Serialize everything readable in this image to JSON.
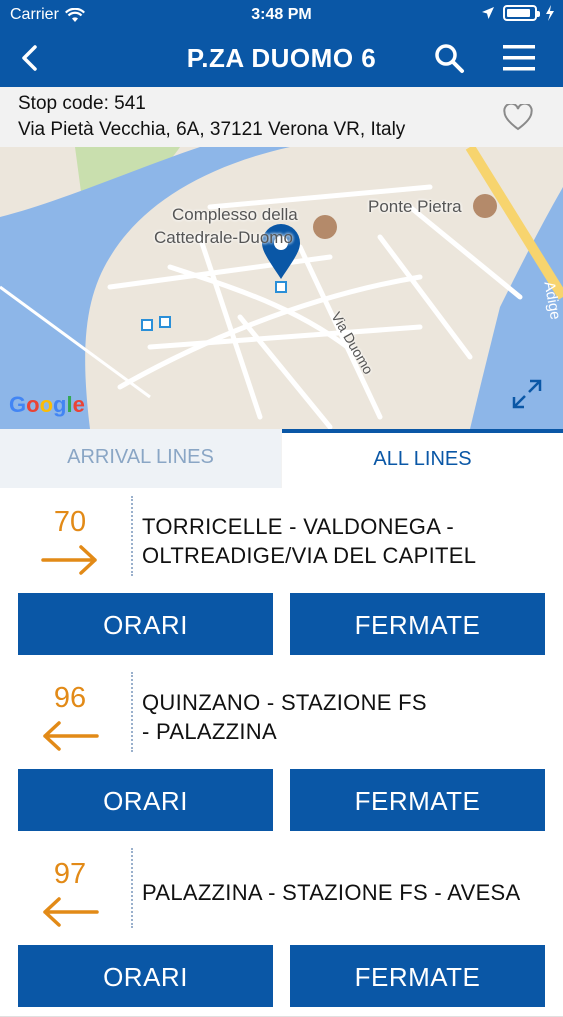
{
  "status_bar": {
    "carrier": "Carrier",
    "time": "3:48 PM",
    "battery_level": 0.9
  },
  "header": {
    "title": "P.ZA DUOMO 6"
  },
  "stop": {
    "code_label": "Stop code: 541",
    "address": "Via Pietà Vecchia, 6A, 37121 Verona VR, Italy"
  },
  "map": {
    "labels": {
      "complesso_1": "Complesso della",
      "complesso_2": "Cattedrale-Duomo",
      "ponte": "Ponte Pietra",
      "via_duomo": "Via Duomo",
      "adige": "Adige"
    },
    "google": "Google"
  },
  "tabs": [
    {
      "label": "ARRIVAL LINES"
    },
    {
      "label": "ALL LINES"
    }
  ],
  "lines": [
    {
      "number": "70",
      "direction": "right",
      "dest_line1": "TORRICELLE - VALDONEGA -",
      "dest_line2": "OLTREADIGE/VIA DEL CAPITEL",
      "orari": "ORARI",
      "fermate": "FERMATE"
    },
    {
      "number": "96",
      "direction": "left",
      "dest_line1": "QUINZANO - STAZIONE FS",
      "dest_line2": "- PALAZZINA",
      "orari": "ORARI",
      "fermate": "FERMATE"
    },
    {
      "number": "97",
      "direction": "left",
      "dest_line1": "PALAZZINA - STAZIONE FS - AVESA",
      "dest_line2": "",
      "orari": "ORARI",
      "fermate": "FERMATE"
    }
  ],
  "colors": {
    "primary": "#0a57a6",
    "accent": "#e28a17"
  }
}
